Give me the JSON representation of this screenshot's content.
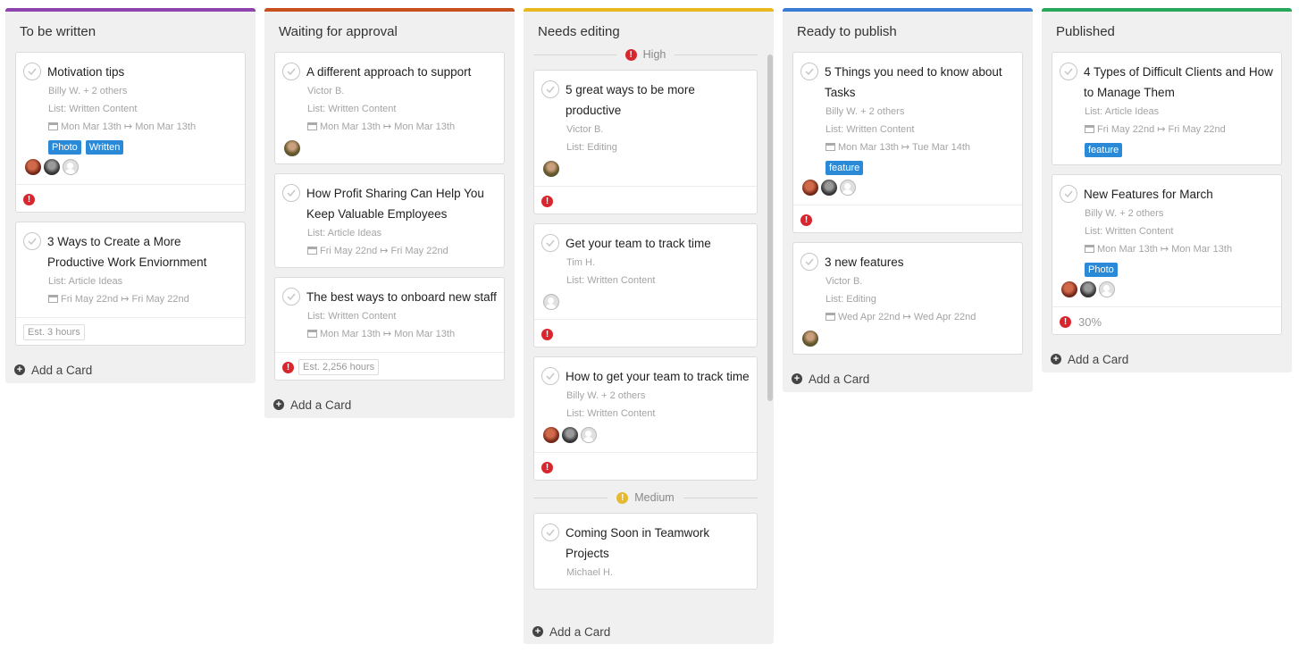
{
  "colors": {
    "col1": "#8e44ad",
    "col2": "#c8501e",
    "col3": "#e8b820",
    "col4": "#3a7bd5",
    "col5": "#27a85a",
    "tag": "#2a8ad8",
    "priority_high": "#d8262f",
    "priority_medium": "#e5b931"
  },
  "add_card_label": "Add a Card",
  "columns": [
    {
      "title": "To be written",
      "cards": [
        {
          "title": "Motivation tips",
          "assignees": "Billy W. + 2 others",
          "list": "List: Written Content",
          "dates": "Mon Mar 13th ↦ Mon Mar 13th",
          "tags": [
            "Photo",
            "Written"
          ]
        },
        {
          "title": "3 Ways to Create a More Productive Work Enviornment",
          "list": "List: Article Ideas",
          "dates": "Fri May 22nd ↦ Fri May 22nd",
          "estimate": "Est. 3 hours"
        }
      ]
    },
    {
      "title": "Waiting for approval",
      "cards": [
        {
          "title": "A different approach to support",
          "assignees": "Victor B.",
          "list": "List: Written Content",
          "dates": "Mon Mar 13th ↦ Mon Mar 13th"
        },
        {
          "title": "How Profit Sharing Can Help You Keep Valuable Employees",
          "list": "List: Article Ideas",
          "dates": "Fri May 22nd ↦ Fri May 22nd"
        },
        {
          "title": "The best ways to onboard new staff",
          "list": "List: Written Content",
          "dates": "Mon Mar 13th ↦ Mon Mar 13th",
          "estimate": "Est. 2,256 hours"
        }
      ]
    },
    {
      "title": "Needs editing",
      "group_high": "High",
      "group_medium": "Medium",
      "cards": [
        {
          "title": "5 great ways to be more productive",
          "assignees": "Victor B.",
          "list": "List: Editing"
        },
        {
          "title": "Get your team to track time",
          "assignees": "Tim H.",
          "list": "List: Written Content"
        },
        {
          "title": "How to get your team to track time",
          "assignees": "Billy W. + 2 others",
          "list": "List: Written Content"
        },
        {
          "title": "Coming Soon in Teamwork Projects",
          "assignees": "Michael H."
        }
      ]
    },
    {
      "title": "Ready to publish",
      "cards": [
        {
          "title": "5 Things you need to know about Tasks",
          "assignees": "Billy W. + 2 others",
          "list": "List: Written Content",
          "dates": "Mon Mar 13th ↦ Tue Mar 14th",
          "tags": [
            "feature"
          ]
        },
        {
          "title": "3 new features",
          "assignees": "Victor B.",
          "list": "List: Editing",
          "dates": "Wed Apr 22nd ↦ Wed Apr 22nd"
        }
      ]
    },
    {
      "title": "Published",
      "cards": [
        {
          "title": "4 Types of Difficult Clients and How to Manage Them",
          "list": "List: Article Ideas",
          "dates": "Fri May 22nd ↦ Fri May 22nd",
          "tags": [
            "feature"
          ]
        },
        {
          "title": "New Features for March",
          "assignees": "Billy W. + 2 others",
          "list": "List: Written Content",
          "dates": "Mon Mar 13th ↦ Mon Mar 13th",
          "tags": [
            "Photo"
          ],
          "progress": "30%"
        }
      ]
    }
  ]
}
